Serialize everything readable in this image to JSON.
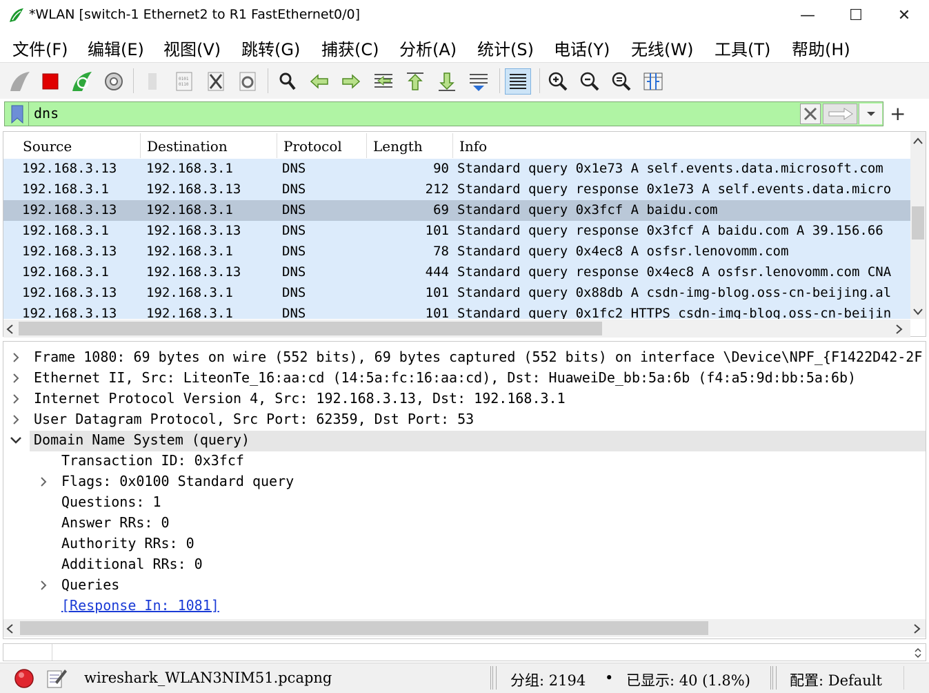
{
  "window": {
    "title": "*WLAN [switch-1 Ethernet2 to R1 FastEthernet0/0]",
    "controls": {
      "minimize": "—",
      "maximize": "☐",
      "close": "✕"
    }
  },
  "menu": [
    "文件(F)",
    "编辑(E)",
    "视图(V)",
    "跳转(G)",
    "捕获(C)",
    "分析(A)",
    "统计(S)",
    "电话(Y)",
    "无线(W)",
    "工具(T)",
    "帮助(H)"
  ],
  "filter": {
    "value": "dns",
    "add": "+"
  },
  "packet_list": {
    "columns": [
      "Source",
      "Destination",
      "Protocol",
      "Length",
      "Info"
    ],
    "rows": [
      {
        "source": "192.168.3.13",
        "destination": "192.168.3.1",
        "protocol": "DNS",
        "length": "90",
        "info": "Standard query 0x1e73 A self.events.data.microsoft.com"
      },
      {
        "source": "192.168.3.1",
        "destination": "192.168.3.13",
        "protocol": "DNS",
        "length": "212",
        "info": "Standard query response 0x1e73 A self.events.data.micro"
      },
      {
        "source": "192.168.3.13",
        "destination": "192.168.3.1",
        "protocol": "DNS",
        "length": "69",
        "info": "Standard query 0x3fcf A baidu.com"
      },
      {
        "source": "192.168.3.1",
        "destination": "192.168.3.13",
        "protocol": "DNS",
        "length": "101",
        "info": "Standard query response 0x3fcf A baidu.com A 39.156.66"
      },
      {
        "source": "192.168.3.13",
        "destination": "192.168.3.1",
        "protocol": "DNS",
        "length": "78",
        "info": "Standard query 0x4ec8 A osfsr.lenovomm.com"
      },
      {
        "source": "192.168.3.1",
        "destination": "192.168.3.13",
        "protocol": "DNS",
        "length": "444",
        "info": "Standard query response 0x4ec8 A osfsr.lenovomm.com CNA"
      },
      {
        "source": "192.168.3.13",
        "destination": "192.168.3.1",
        "protocol": "DNS",
        "length": "101",
        "info": "Standard query 0x88db A csdn-img-blog.oss-cn-beijing.al"
      },
      {
        "source": "192.168.3.13",
        "destination": "192.168.3.1",
        "protocol": "DNS",
        "length": "101",
        "info": "Standard query 0x1fc2 HTTPS csdn-img-blog.oss-cn-beijin"
      }
    ],
    "selected_index": 2
  },
  "details": [
    {
      "text": "Frame 1080: 69 bytes on wire (552 bits), 69 bytes captured (552 bits) on interface \\Device\\NPF_{F1422D42-2F",
      "expander": "›"
    },
    {
      "text": "Ethernet II, Src: LiteonTe_16:aa:cd (14:5a:fc:16:aa:cd), Dst: HuaweiDe_bb:5a:6b (f4:a5:9d:bb:5a:6b)",
      "expander": "›"
    },
    {
      "text": "Internet Protocol Version 4, Src: 192.168.3.13, Dst: 192.168.3.1",
      "expander": "›"
    },
    {
      "text": "User Datagram Protocol, Src Port: 62359, Dst Port: 53",
      "expander": "›"
    },
    {
      "text": "Domain Name System (query)",
      "expander": "⌄"
    },
    {
      "text": "Transaction ID: 0x3fcf",
      "expander": ""
    },
    {
      "text": "Flags: 0x0100 Standard query",
      "expander": "›"
    },
    {
      "text": "Questions: 1",
      "expander": ""
    },
    {
      "text": "Answer RRs: 0",
      "expander": ""
    },
    {
      "text": "Authority RRs: 0",
      "expander": ""
    },
    {
      "text": "Additional RRs: 0",
      "expander": ""
    },
    {
      "text": "Queries",
      "expander": "›"
    },
    {
      "text": "[Response In: 1081]",
      "expander": ""
    }
  ],
  "status": {
    "file": "wireshark_WLAN3NIM51.pcapng",
    "packets": "分组: 2194",
    "bullet": "•",
    "displayed": "已显示: 40 (1.8%)",
    "profile": "配置: Default"
  },
  "colors": {
    "filter_valid": "#b0f4a4",
    "row_bg": "#dcebfb",
    "row_selected": "#bac8d8",
    "link": "#1a3bd6"
  }
}
